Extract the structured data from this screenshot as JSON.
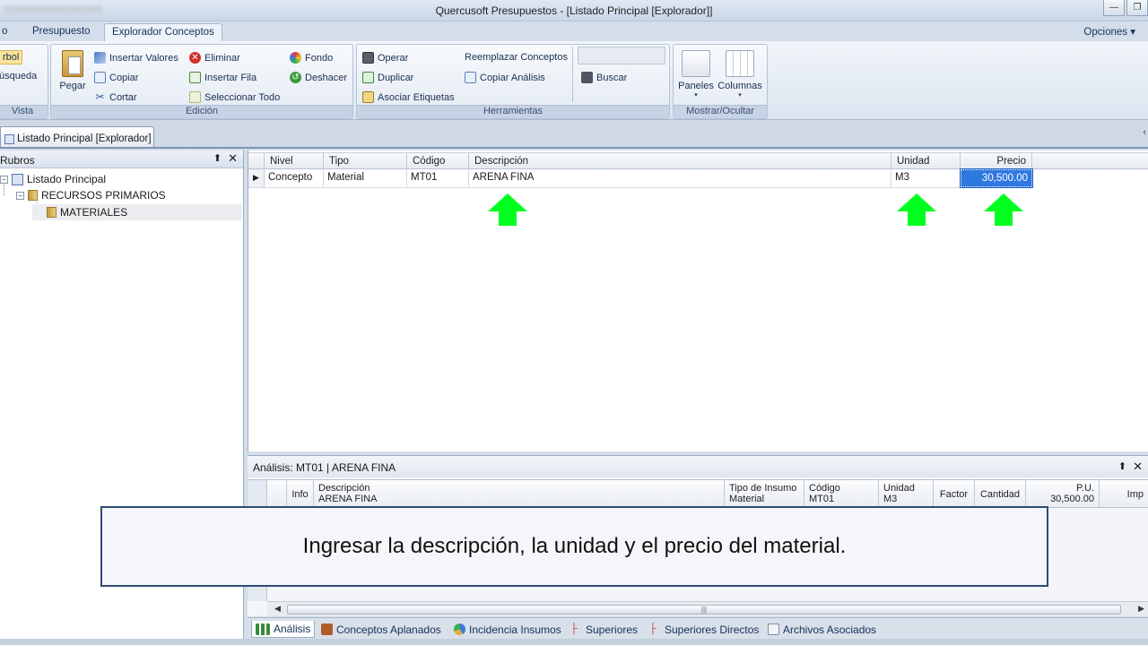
{
  "window": {
    "title": "Quercusoft Presupuestos - [Listado Principal [Explorador]]"
  },
  "ribbon_tabs": [
    {
      "label": "o"
    },
    {
      "label": "Presupuesto"
    },
    {
      "label": "Explorador Conceptos"
    }
  ],
  "options_label": "Opciones",
  "vista_group": {
    "items": [
      "rbol",
      "úsqueda"
    ],
    "title": "Vista"
  },
  "edicion_group": {
    "title": "Edición",
    "paste": "Pegar",
    "insert_values": "Insertar Valores",
    "copy": "Copiar",
    "cut": "Cortar",
    "delete": "Eliminar",
    "insert_row": "Insertar Fila",
    "select_all": "Seleccionar Todo",
    "background": "Fondo",
    "undo": "Deshacer"
  },
  "herramientas_group": {
    "title": "Herramientas",
    "operate": "Operar",
    "duplicate": "Duplicar",
    "associate_labels": "Asociar Etiquetas",
    "replace_concepts": "Reemplazar Conceptos",
    "copy_analysis": "Copiar Análisis",
    "search": "Buscar"
  },
  "mostrar_group": {
    "title": "Mostrar/Ocultar",
    "panels": "Paneles",
    "columns": "Columnas"
  },
  "doc_tab": "Listado Principal [Explorador]",
  "left_panel": {
    "title": "Rubros",
    "tree": [
      {
        "label": "Listado Principal"
      },
      {
        "label": "RECURSOS PRIMARIOS"
      },
      {
        "label": "MATERIALES"
      }
    ]
  },
  "grid": {
    "columns": [
      "Nivel",
      "Tipo",
      "Código",
      "Descripción",
      "Unidad",
      "Precio"
    ],
    "rows": [
      {
        "nivel": "Concepto",
        "tipo": "Material",
        "codigo": "MT01",
        "descripcion": "ARENA FINA",
        "unidad": "M3",
        "precio": "30,500.00"
      }
    ]
  },
  "analysis": {
    "title": "Análisis: MT01 | ARENA FINA",
    "info": "Info",
    "descripcion_label": "Descripción",
    "descripcion_value": "ARENA FINA",
    "tipo_label": "Tipo de Insumo",
    "tipo_value": "Material",
    "codigo_label": "Código",
    "codigo_value": "MT01",
    "unidad_label": "Unidad",
    "unidad_value": "M3",
    "factor": "Factor",
    "cantidad": "Cantidad",
    "pu_label": "P.U.",
    "pu_value": "30,500.00",
    "imp": "Imp"
  },
  "bottom_tabs": [
    {
      "label": "Análisis"
    },
    {
      "label": "Conceptos Aplanados"
    },
    {
      "label": "Incidencia Insumos"
    },
    {
      "label": "Superiores"
    },
    {
      "label": "Superiores Directos"
    },
    {
      "label": "Archivos Asociados"
    }
  ],
  "caption": "Ingresar la descripción, la unidad y el precio del material."
}
